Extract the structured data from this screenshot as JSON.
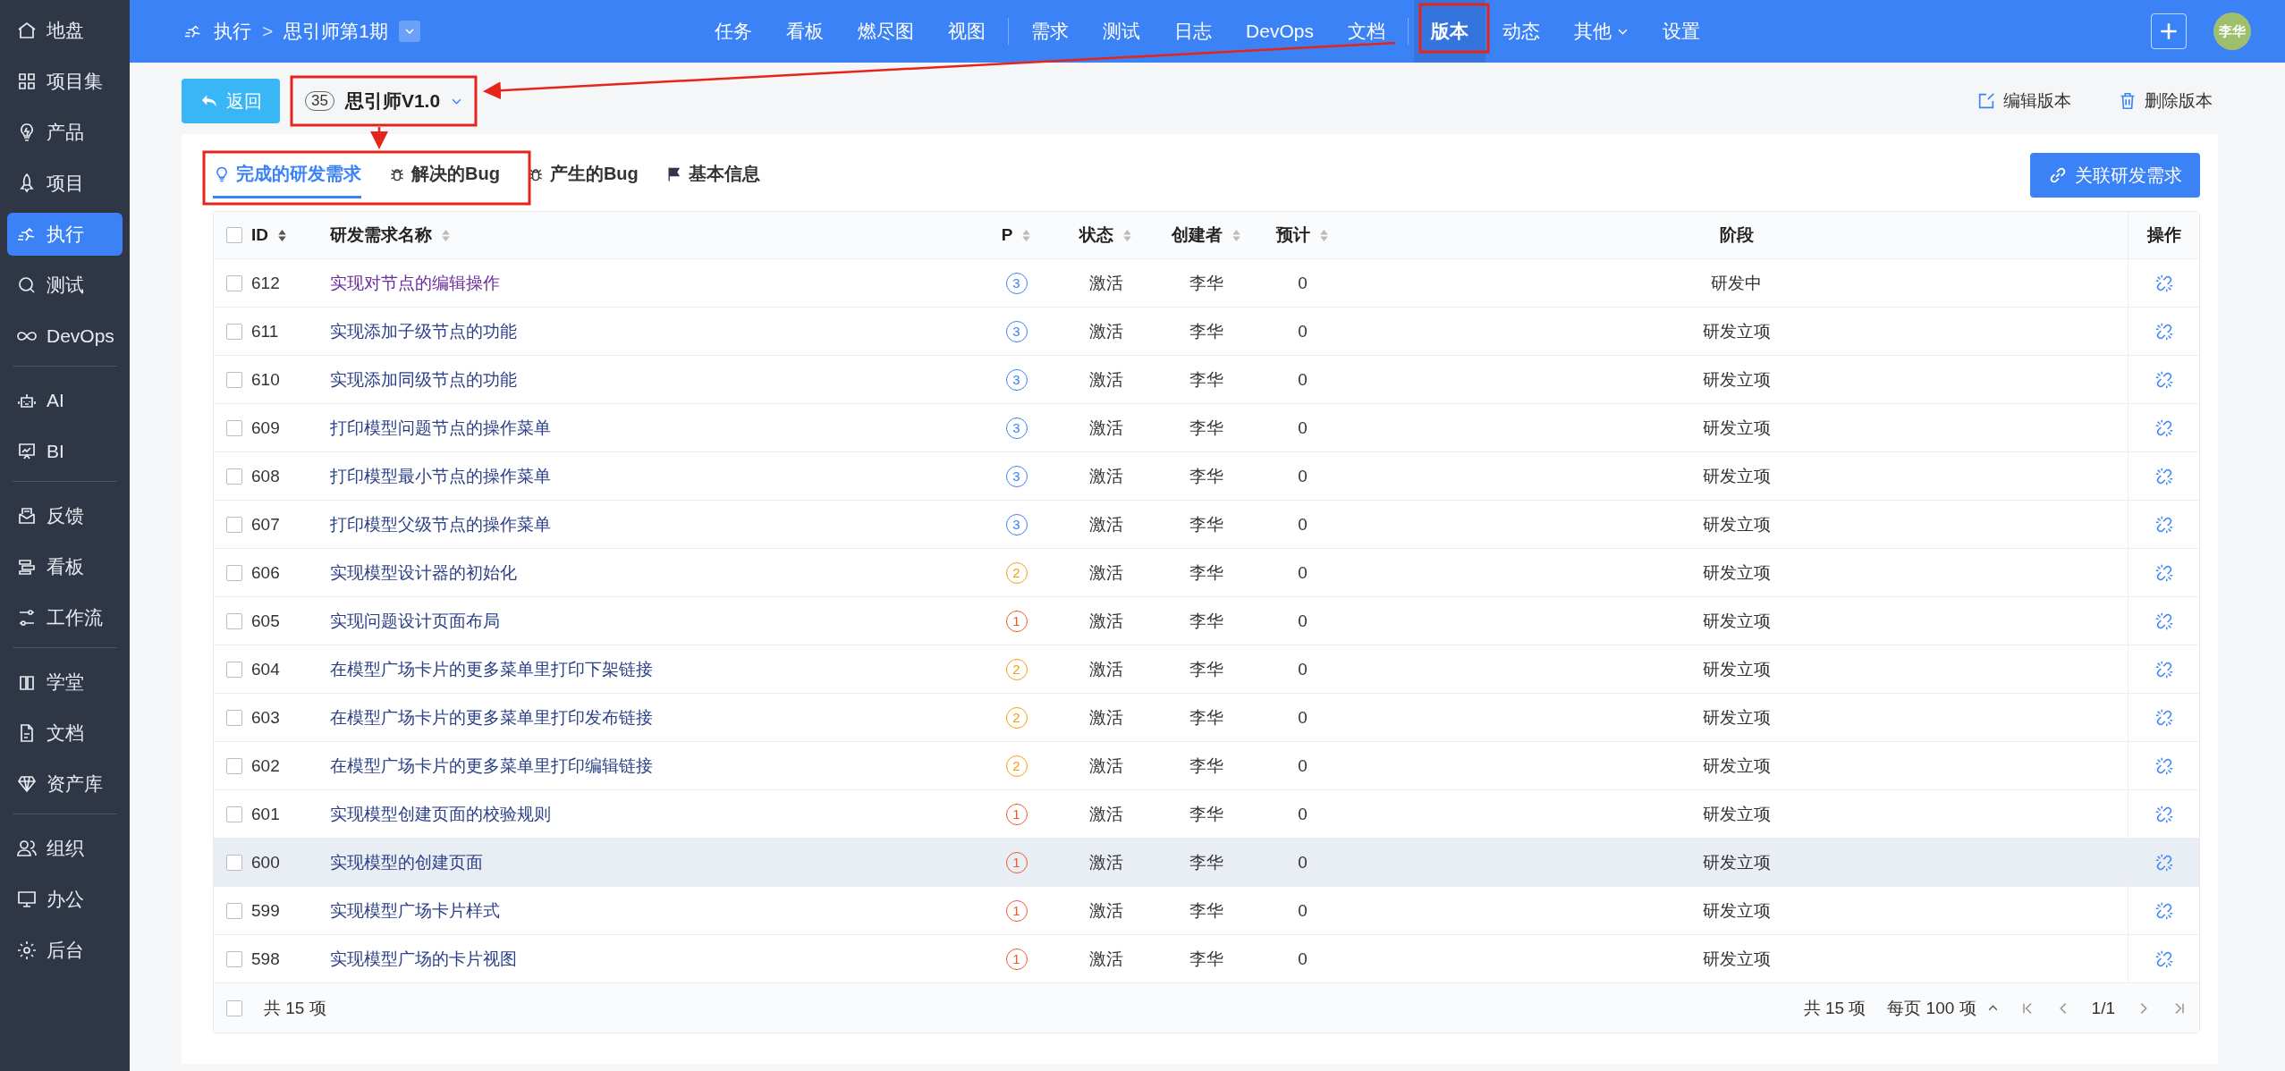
{
  "sidebar": {
    "groups": [
      [
        {
          "label": "地盘",
          "selected": false
        },
        {
          "label": "项目集",
          "selected": false
        },
        {
          "label": "产品",
          "selected": false
        },
        {
          "label": "项目",
          "selected": false
        },
        {
          "label": "执行",
          "selected": true
        },
        {
          "label": "测试",
          "selected": false
        },
        {
          "label": "DevOps",
          "selected": false
        }
      ],
      [
        {
          "label": "AI",
          "selected": false
        },
        {
          "label": "BI",
          "selected": false
        }
      ],
      [
        {
          "label": "反馈",
          "selected": false
        },
        {
          "label": "看板",
          "selected": false
        },
        {
          "label": "工作流",
          "selected": false
        }
      ],
      [
        {
          "label": "学堂",
          "selected": false
        },
        {
          "label": "文档",
          "selected": false
        },
        {
          "label": "资产库",
          "selected": false
        }
      ],
      [
        {
          "label": "组织",
          "selected": false
        },
        {
          "label": "办公",
          "selected": false
        },
        {
          "label": "后台",
          "selected": false
        }
      ]
    ]
  },
  "topbar": {
    "breadcrumb": {
      "module": "执行",
      "separator": ">",
      "execution": "思引师第1期"
    },
    "nav_groups": [
      [
        {
          "label": "任务",
          "selected": false,
          "dropdown": false
        },
        {
          "label": "看板",
          "selected": false,
          "dropdown": false
        },
        {
          "label": "燃尽图",
          "selected": false,
          "dropdown": false
        },
        {
          "label": "视图",
          "selected": false,
          "dropdown": false
        }
      ],
      [
        {
          "label": "需求",
          "selected": false,
          "dropdown": false
        },
        {
          "label": "测试",
          "selected": false,
          "dropdown": false
        },
        {
          "label": "日志",
          "selected": false,
          "dropdown": false
        },
        {
          "label": "DevOps",
          "selected": false,
          "dropdown": false
        },
        {
          "label": "文档",
          "selected": false,
          "dropdown": false
        }
      ],
      [
        {
          "label": "版本",
          "selected": true,
          "dropdown": false
        },
        {
          "label": "动态",
          "selected": false,
          "dropdown": false
        },
        {
          "label": "其他",
          "selected": false,
          "dropdown": true
        },
        {
          "label": "设置",
          "selected": false,
          "dropdown": false
        }
      ]
    ],
    "avatar": "李华"
  },
  "header": {
    "back_button": "返回",
    "build": {
      "id": "35",
      "name": "思引师V1.0"
    },
    "actions": [
      "编辑版本",
      "删除版本"
    ]
  },
  "tabs": [
    {
      "label": "完成的研发需求",
      "selected": true
    },
    {
      "label": "解决的Bug",
      "selected": false
    },
    {
      "label": "产生的Bug",
      "selected": false
    },
    {
      "label": "基本信息",
      "selected": false
    }
  ],
  "link_button": "关联研发需求",
  "table": {
    "select_all_checked": false,
    "columns": [
      "ID",
      "研发需求名称",
      "P",
      "状态",
      "创建者",
      "预计",
      "阶段",
      "操作"
    ],
    "rows": [
      {
        "id": "612",
        "name": "实现对节点的编辑操作",
        "visited": true,
        "highlighted": false,
        "checked": false,
        "priority": {
          "text": "3",
          "color": "#3b82f6"
        },
        "status": "激活",
        "creator": "李华",
        "estimate": "0",
        "stage": "研发中"
      },
      {
        "id": "611",
        "name": "实现添加子级节点的功能",
        "visited": false,
        "highlighted": false,
        "checked": false,
        "priority": {
          "text": "3",
          "color": "#3b82f6"
        },
        "status": "激活",
        "creator": "李华",
        "estimate": "0",
        "stage": "研发立项"
      },
      {
        "id": "610",
        "name": "实现添加同级节点的功能",
        "visited": false,
        "highlighted": false,
        "checked": false,
        "priority": {
          "text": "3",
          "color": "#3b82f6"
        },
        "status": "激活",
        "creator": "李华",
        "estimate": "0",
        "stage": "研发立项"
      },
      {
        "id": "609",
        "name": "打印模型问题节点的操作菜单",
        "visited": false,
        "highlighted": false,
        "checked": false,
        "priority": {
          "text": "3",
          "color": "#3b82f6"
        },
        "status": "激活",
        "creator": "李华",
        "estimate": "0",
        "stage": "研发立项"
      },
      {
        "id": "608",
        "name": "打印模型最小节点的操作菜单",
        "visited": false,
        "highlighted": false,
        "checked": false,
        "priority": {
          "text": "3",
          "color": "#3b82f6"
        },
        "status": "激活",
        "creator": "李华",
        "estimate": "0",
        "stage": "研发立项"
      },
      {
        "id": "607",
        "name": "打印模型父级节点的操作菜单",
        "visited": false,
        "highlighted": false,
        "checked": false,
        "priority": {
          "text": "3",
          "color": "#3b82f6"
        },
        "status": "激活",
        "creator": "李华",
        "estimate": "0",
        "stage": "研发立项"
      },
      {
        "id": "606",
        "name": "实现模型设计器的初始化",
        "visited": false,
        "highlighted": false,
        "checked": false,
        "priority": {
          "text": "2",
          "color": "#f59e0b"
        },
        "status": "激活",
        "creator": "李华",
        "estimate": "0",
        "stage": "研发立项"
      },
      {
        "id": "605",
        "name": "实现问题设计页面布局",
        "visited": false,
        "highlighted": false,
        "checked": false,
        "priority": {
          "text": "1",
          "color": "#ef5a2a"
        },
        "status": "激活",
        "creator": "李华",
        "estimate": "0",
        "stage": "研发立项"
      },
      {
        "id": "604",
        "name": "在模型广场卡片的更多菜单里打印下架链接",
        "visited": false,
        "highlighted": false,
        "checked": false,
        "priority": {
          "text": "2",
          "color": "#f59e0b"
        },
        "status": "激活",
        "creator": "李华",
        "estimate": "0",
        "stage": "研发立项"
      },
      {
        "id": "603",
        "name": "在模型广场卡片的更多菜单里打印发布链接",
        "visited": false,
        "highlighted": false,
        "checked": false,
        "priority": {
          "text": "2",
          "color": "#f59e0b"
        },
        "status": "激活",
        "creator": "李华",
        "estimate": "0",
        "stage": "研发立项"
      },
      {
        "id": "602",
        "name": "在模型广场卡片的更多菜单里打印编辑链接",
        "visited": false,
        "highlighted": false,
        "checked": false,
        "priority": {
          "text": "2",
          "color": "#f59e0b"
        },
        "status": "激活",
        "creator": "李华",
        "estimate": "0",
        "stage": "研发立项"
      },
      {
        "id": "601",
        "name": "实现模型创建页面的校验规则",
        "visited": false,
        "highlighted": false,
        "checked": false,
        "priority": {
          "text": "1",
          "color": "#ef5a2a"
        },
        "status": "激活",
        "creator": "李华",
        "estimate": "0",
        "stage": "研发立项"
      },
      {
        "id": "600",
        "name": "实现模型的创建页面",
        "visited": false,
        "highlighted": true,
        "checked": false,
        "priority": {
          "text": "1",
          "color": "#ef5a2a"
        },
        "status": "激活",
        "creator": "李华",
        "estimate": "0",
        "stage": "研发立项"
      },
      {
        "id": "599",
        "name": "实现模型广场卡片样式",
        "visited": false,
        "highlighted": false,
        "checked": false,
        "priority": {
          "text": "1",
          "color": "#ef5a2a"
        },
        "status": "激活",
        "creator": "李华",
        "estimate": "0",
        "stage": "研发立项"
      },
      {
        "id": "598",
        "name": "实现模型广场的卡片视图",
        "visited": false,
        "highlighted": false,
        "checked": false,
        "priority": {
          "text": "1",
          "color": "#ef5a2a"
        },
        "status": "激活",
        "creator": "李华",
        "estimate": "0",
        "stage": "研发立项"
      }
    ],
    "footer": {
      "checked": false,
      "summary": "共 15 项",
      "total": "共 15 项",
      "per_page": "每页 100 项",
      "page": "1/1"
    }
  }
}
